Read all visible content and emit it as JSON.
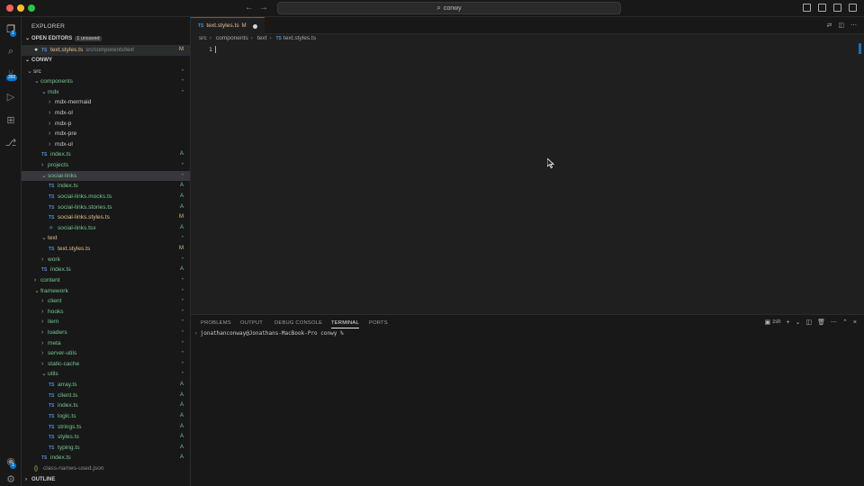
{
  "window": {
    "search_text": "conwy",
    "back_icon": "arrow-left-icon",
    "forward_icon": "arrow-right-icon"
  },
  "activity": {
    "explorer_badge": "1",
    "scm_badge": "392",
    "accounts_badge": "1"
  },
  "sidebar": {
    "title": "EXPLORER",
    "open_editors_label": "OPEN EDITORS",
    "unsaved_badge": "1 unsaved",
    "open_editor": {
      "name": "text.styles.ts",
      "path": "src/components/text",
      "status": "M"
    },
    "workspace_label": "CONWY",
    "outline_label": "OUTLINE",
    "tree": [
      {
        "name": "src",
        "kind": "folder-open",
        "status": "•",
        "color": "folder"
      },
      {
        "name": "components",
        "kind": "folder-open",
        "status": "•",
        "color": "added"
      },
      {
        "name": "mdx",
        "kind": "folder-open",
        "status": "•",
        "color": "added"
      },
      {
        "name": "mdx-mermaid",
        "kind": "folder",
        "status": "",
        "color": "folder"
      },
      {
        "name": "mdx-ol",
        "kind": "folder",
        "status": "",
        "color": "folder"
      },
      {
        "name": "mdx-p",
        "kind": "folder",
        "status": "",
        "color": "folder"
      },
      {
        "name": "mdx-pre",
        "kind": "folder",
        "status": "",
        "color": "folder"
      },
      {
        "name": "mdx-ul",
        "kind": "folder",
        "status": "",
        "color": "folder"
      },
      {
        "name": "index.ts",
        "kind": "ts",
        "status": "A",
        "color": "added"
      },
      {
        "name": "projects",
        "kind": "folder",
        "status": "•",
        "color": "added"
      },
      {
        "name": "social-links",
        "kind": "folder-open",
        "status": "•",
        "color": "added"
      },
      {
        "name": "index.ts",
        "kind": "ts",
        "status": "A",
        "color": "added"
      },
      {
        "name": "social-links.mocks.ts",
        "kind": "ts",
        "status": "A",
        "color": "added"
      },
      {
        "name": "social-links.stories.ts",
        "kind": "ts",
        "status": "A",
        "color": "added"
      },
      {
        "name": "social-links.styles.ts",
        "kind": "ts",
        "status": "M",
        "color": "mod"
      },
      {
        "name": "social-links.tsx",
        "kind": "tsx",
        "status": "A",
        "color": "added"
      },
      {
        "name": "text",
        "kind": "folder-open",
        "status": "•",
        "color": "mod"
      },
      {
        "name": "text.styles.ts",
        "kind": "ts",
        "status": "M",
        "color": "mod"
      },
      {
        "name": "work",
        "kind": "folder",
        "status": "•",
        "color": "added"
      },
      {
        "name": "index.ts",
        "kind": "ts",
        "status": "A",
        "color": "added"
      },
      {
        "name": "content",
        "kind": "folder",
        "status": "•",
        "color": "added"
      },
      {
        "name": "framework",
        "kind": "folder-open",
        "status": "•",
        "color": "added"
      },
      {
        "name": "client",
        "kind": "folder",
        "status": "•",
        "color": "added"
      },
      {
        "name": "hooks",
        "kind": "folder",
        "status": "•",
        "color": "added"
      },
      {
        "name": "item",
        "kind": "folder",
        "status": "•",
        "color": "added"
      },
      {
        "name": "loaders",
        "kind": "folder",
        "status": "•",
        "color": "added"
      },
      {
        "name": "meta",
        "kind": "folder",
        "status": "•",
        "color": "added"
      },
      {
        "name": "server-utils",
        "kind": "folder",
        "status": "•",
        "color": "added"
      },
      {
        "name": "static-cache",
        "kind": "folder",
        "status": "•",
        "color": "added"
      },
      {
        "name": "utils",
        "kind": "folder-open",
        "status": "•",
        "color": "added"
      },
      {
        "name": "array.ts",
        "kind": "ts",
        "status": "A",
        "color": "added"
      },
      {
        "name": "client.ts",
        "kind": "ts",
        "status": "A",
        "color": "added"
      },
      {
        "name": "index.ts",
        "kind": "ts",
        "status": "A",
        "color": "added"
      },
      {
        "name": "logic.ts",
        "kind": "ts",
        "status": "A",
        "color": "added"
      },
      {
        "name": "strings.ts",
        "kind": "ts",
        "status": "A",
        "color": "added"
      },
      {
        "name": "styles.ts",
        "kind": "ts",
        "status": "A",
        "color": "added"
      },
      {
        "name": "typing.ts",
        "kind": "ts",
        "status": "A",
        "color": "added"
      },
      {
        "name": "index.ts",
        "kind": "ts",
        "status": "A",
        "color": "added"
      },
      {
        "name": "class-names-used.json",
        "kind": "json",
        "status": "",
        "color": "dim"
      }
    ]
  },
  "editor": {
    "tab_label": "text.styles.ts",
    "tab_status": "M",
    "breadcrumb": [
      "src",
      "components",
      "text",
      "text.styles.ts"
    ],
    "line_number": "1"
  },
  "panel": {
    "tabs": [
      "PROBLEMS",
      "OUTPUT",
      "DEBUG CONSOLE",
      "TERMINAL",
      "PORTS"
    ],
    "active_tab": "TERMINAL",
    "shell_label": "zsh",
    "prompt": "jonathanconway@Jonathans-MacBook-Pro conwy %"
  },
  "colors": {
    "accent": "#0078d4",
    "added": "#73c991",
    "modified": "#e2c08d"
  }
}
